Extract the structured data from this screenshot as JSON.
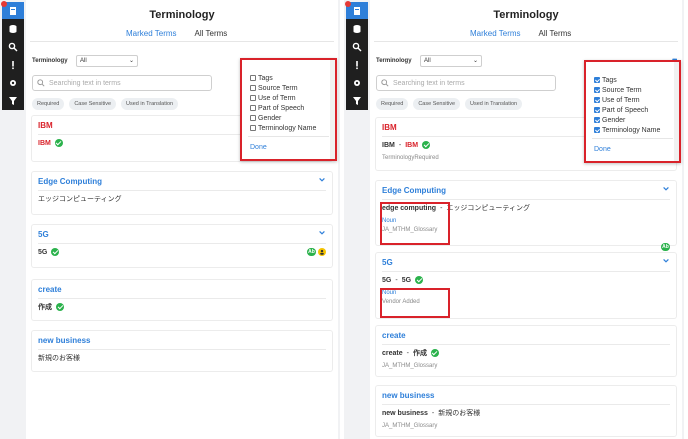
{
  "title": "Terminology",
  "tabs": [
    "Marked Terms",
    "All Terms"
  ],
  "filter": {
    "label": "Terminology",
    "value": "All"
  },
  "search": {
    "placeholder": "Searching text in terms"
  },
  "chips": [
    "Required",
    "Case Sensitive",
    "Used in Translation"
  ],
  "popup": {
    "options": [
      "Tags",
      "Source Term",
      "Use of Term",
      "Part of Speech",
      "Gender",
      "Terminology Name"
    ],
    "done": "Done"
  },
  "more_label": "•••",
  "left_cards": [
    {
      "head": "IBM",
      "term": "IBM"
    },
    {
      "head": "Edge Computing",
      "text": "エッジコンピューティング"
    },
    {
      "head": "5G",
      "term": "5G",
      "badge": "Ab"
    },
    {
      "head": "create",
      "term": "作成"
    },
    {
      "head": "new business",
      "text": "新規のお客様"
    }
  ],
  "right_cards": [
    {
      "head": "IBM",
      "source": "IBM",
      "dash": "-",
      "target": "IBM",
      "sub": "TerminologyRequired"
    },
    {
      "head": "Edge Computing",
      "source": "edge computing",
      "dash": "-",
      "target": "エッジコンピューティング",
      "pos": "Noun",
      "glossary": "JA_MTHM_Glossary"
    },
    {
      "head": "5G",
      "source": "5G",
      "dash": "-",
      "target": "5G",
      "badge": "Ab",
      "pos": "Noun",
      "vendor": "Vendor Added"
    },
    {
      "head": "create",
      "source": "create",
      "dash": "-",
      "target": "作成",
      "glossary": "JA_MTHM_Glossary"
    },
    {
      "head": "new business",
      "source": "new business",
      "dash": "-",
      "target": "新規のお客様",
      "glossary": "JA_MTHM_Glossary"
    }
  ],
  "colors": {
    "accent": "#2e7fd9",
    "highlight": "#d9222a",
    "check": "#2bb24c",
    "rail": "#1f1f1f"
  }
}
